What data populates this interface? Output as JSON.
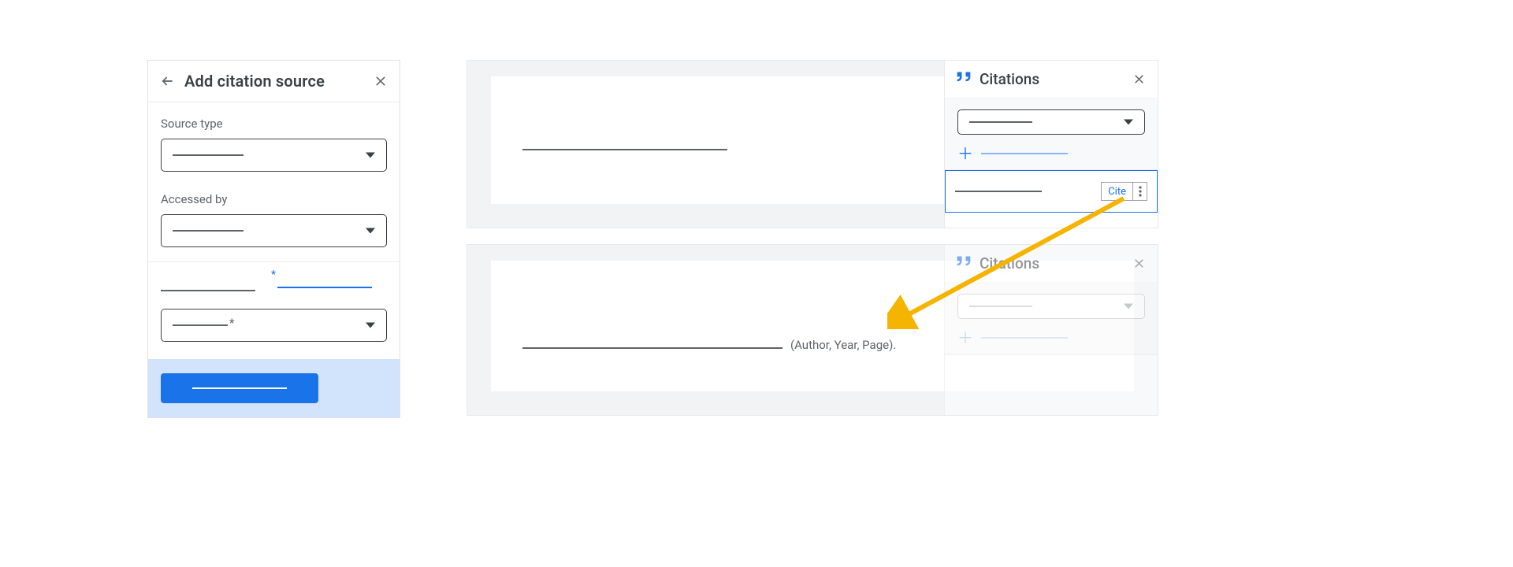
{
  "add_panel": {
    "title": "Add citation source",
    "labels": {
      "source_type": "Source type",
      "accessed_by": "Accessed by"
    }
  },
  "citations_panel": {
    "title": "Citations",
    "cite_button": "Cite"
  },
  "doc": {
    "inline_citation": "(Author, Year, Page)."
  }
}
